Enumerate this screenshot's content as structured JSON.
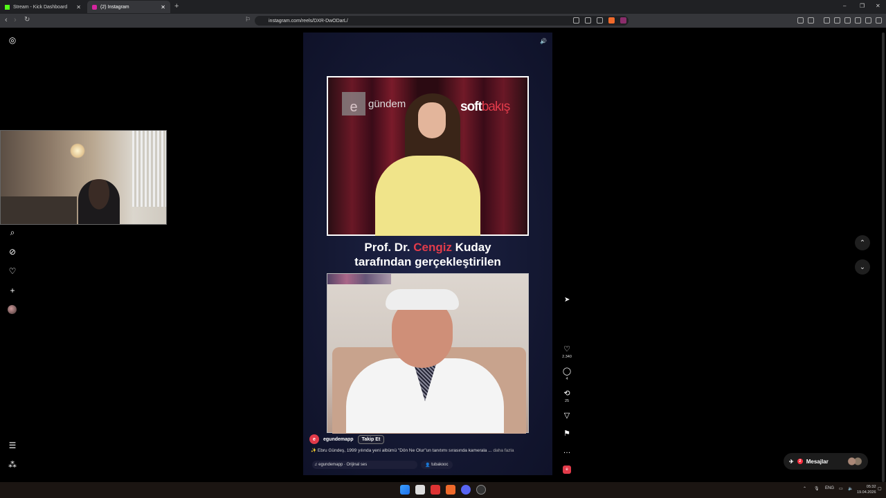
{
  "browser": {
    "tabs": [
      {
        "title": "Stream - Kick Dashboard"
      },
      {
        "title": "(2) Instagram"
      }
    ],
    "url": "instagram.com/reels/DXR-DwODarL/"
  },
  "reel": {
    "overlay": {
      "brand_left": "gündem",
      "brand_right_1": "soft",
      "brand_right_2": "bakış"
    },
    "caption": {
      "line1_pre": "Prof. Dr. ",
      "line1_red": "Cengiz",
      "line1_post": " Kuday",
      "line2": "tarafından gerçekleştirilen"
    },
    "account": "egundemapp",
    "follow_label": "Takip Et",
    "description": "✨ Ebru Gündeş, 1999 yılında yeni albümü \"Dön Ne Olur\"un tanıtımı sırasında kamerala ...",
    "more_label": "daha fazla",
    "audio": "egundemapp · Orijinal ses",
    "tagged_user": "tubakooc",
    "likes": "2.340",
    "comments": "4",
    "reposts": "25"
  },
  "messages": {
    "label": "Mesajlar",
    "badge": "2"
  },
  "taskbar": {
    "language": "ENG",
    "time": "05:32",
    "date": "19.04.2026"
  },
  "colors": {
    "accent_red": "#e23b4a",
    "reel_bg": "#141832"
  }
}
